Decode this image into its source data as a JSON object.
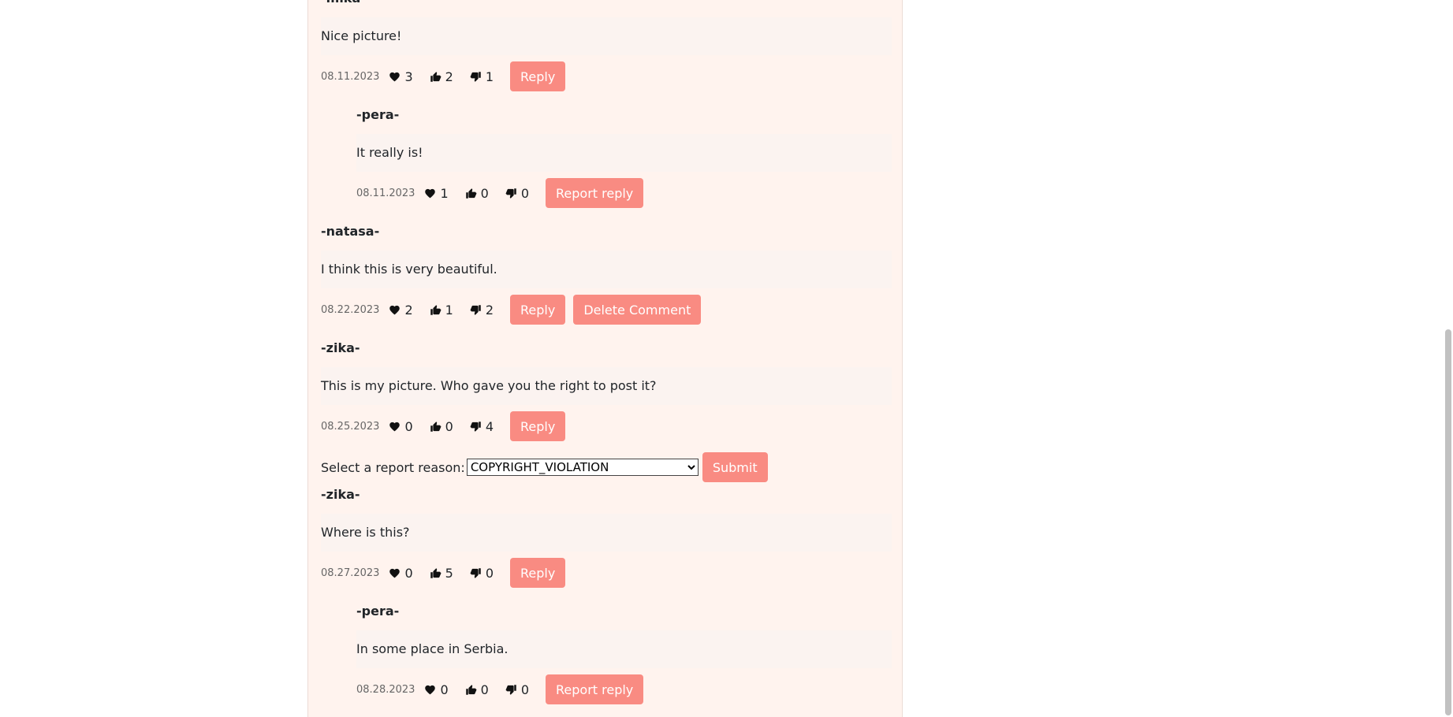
{
  "comments": [
    {
      "author": "-mika-",
      "text": "Nice picture!",
      "date": "08.11.2023",
      "hearts": "3",
      "likes": "2",
      "dislikes": "1",
      "buttons": [
        "Reply"
      ]
    },
    {
      "author": "-pera-",
      "text": "It really is!",
      "date": "08.11.2023",
      "hearts": "1",
      "likes": "0",
      "dislikes": "0",
      "buttons": [
        "Report reply"
      ]
    },
    {
      "author": "-natasa-",
      "text": "I think this is very beautiful.",
      "date": "08.22.2023",
      "hearts": "2",
      "likes": "1",
      "dislikes": "2",
      "buttons": [
        "Reply",
        "Delete Comment"
      ]
    },
    {
      "author": "-zika-",
      "text": "This is my picture. Who gave you the right to post it?",
      "date": "08.25.2023",
      "hearts": "0",
      "likes": "0",
      "dislikes": "4",
      "buttons": [
        "Reply"
      ]
    },
    {
      "author": "-zika-",
      "text": "Where is this?",
      "date": "08.27.2023",
      "hearts": "0",
      "likes": "5",
      "dislikes": "0",
      "buttons": [
        "Reply"
      ]
    },
    {
      "author": "-pera-",
      "text": "In some place in Serbia.",
      "date": "08.28.2023",
      "hearts": "0",
      "likes": "0",
      "dislikes": "0",
      "buttons": [
        "Report reply"
      ]
    }
  ],
  "report_form": {
    "label": "Select a report reason:",
    "selected": "COPYRIGHT_VIOLATION",
    "submit_label": "Submit"
  },
  "colors": {
    "button": "#f98b82",
    "panel": "#fff3ee",
    "text_box": "#fbf3f0"
  },
  "icons": {
    "heart": "heart-icon",
    "like": "thumbs-up-icon",
    "dislike": "thumbs-down-icon"
  }
}
